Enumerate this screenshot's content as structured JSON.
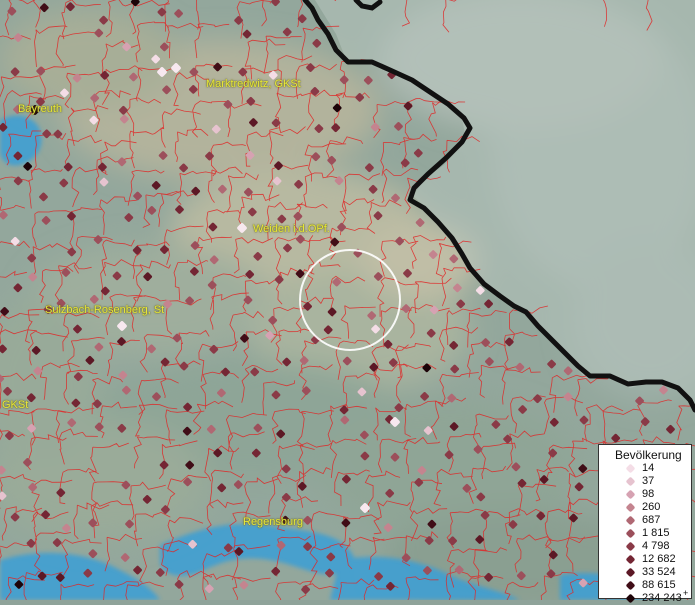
{
  "legend": {
    "title": "Bevölkerung",
    "items": [
      {
        "label": "14",
        "color": "#f4dde6"
      },
      {
        "label": "37",
        "color": "#e6c3cf"
      },
      {
        "label": "98",
        "color": "#d6a2b2"
      },
      {
        "label": "260",
        "color": "#c4848f"
      },
      {
        "label": "687",
        "color": "#b06873"
      },
      {
        "label": "1 815",
        "color": "#9c4f5b"
      },
      {
        "label": "4 798",
        "color": "#8a3a47"
      },
      {
        "label": "12 682",
        "color": "#742634"
      },
      {
        "label": "33 524",
        "color": "#5c1825"
      },
      {
        "label": "88 615",
        "color": "#400d17"
      },
      {
        "label": "234 243",
        "color": "#1c0308"
      }
    ],
    "overflow_marker": "+"
  },
  "places": [
    {
      "id": "marktredwitz",
      "label": "Marktredwitz, GKSt"
    },
    {
      "id": "bayreuth",
      "label": "Bayreuth"
    },
    {
      "id": "weiden",
      "label": "Weiden i.d.OPf."
    },
    {
      "id": "sulzbach",
      "label": "Sulzbach-Rosenberg, St"
    },
    {
      "id": "gkst",
      "label": "GKSt"
    },
    {
      "id": "regensburg",
      "label": "Regensburg"
    }
  ],
  "colors": {
    "border": "#111111",
    "municipal_lines": "#e02424",
    "water": "#3a9fd6",
    "highlight_circle": "#ffffff"
  }
}
